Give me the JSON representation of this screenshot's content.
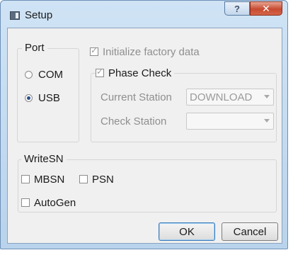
{
  "window": {
    "title": "Setup",
    "help_label": "?",
    "close_label": "✕"
  },
  "port": {
    "label": "Port",
    "options": [
      {
        "label": "COM",
        "checked": false
      },
      {
        "label": "USB",
        "checked": true
      }
    ]
  },
  "initialize": {
    "label": "Initialize factory data",
    "checked": true,
    "enabled": false
  },
  "phase_check": {
    "label": "Phase Check",
    "checked": true,
    "enabled": false,
    "current_station_label": "Current Station",
    "current_station_value": "DOWNLOAD",
    "check_station_label": "Check Station",
    "check_station_value": ""
  },
  "writesn": {
    "label": "WriteSN",
    "mbsn_label": "MBSN",
    "psn_label": "PSN",
    "autogen_label": "AutoGen"
  },
  "buttons": {
    "ok": "OK",
    "cancel": "Cancel"
  }
}
